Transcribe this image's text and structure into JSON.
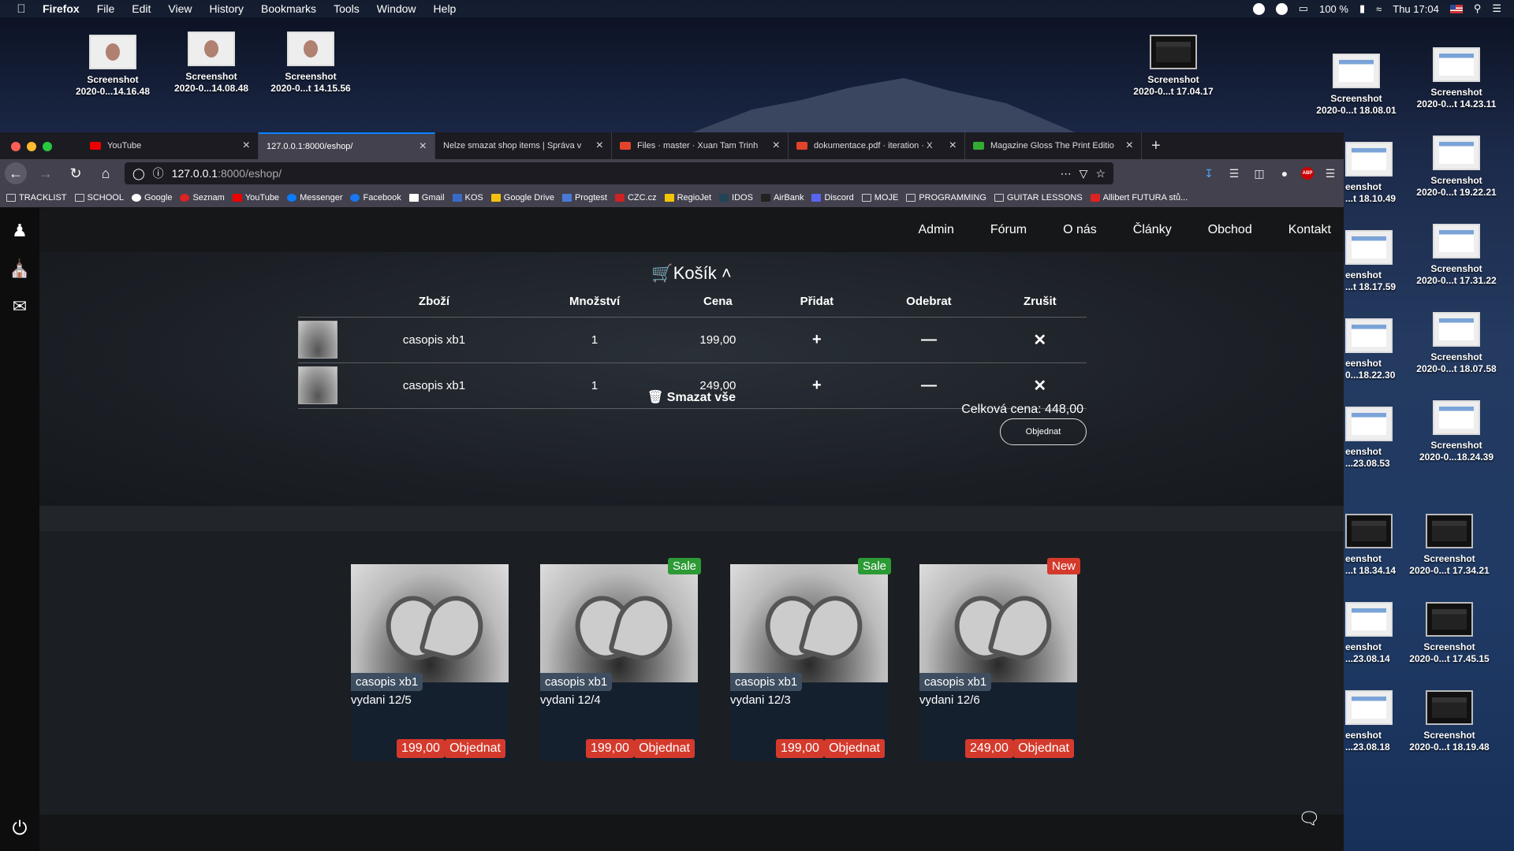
{
  "menubar": {
    "app": "Firefox",
    "items": [
      "File",
      "Edit",
      "View",
      "History",
      "Bookmarks",
      "Tools",
      "Window"
    ],
    "help": "Help",
    "battery": "100 %",
    "clock": "Thu 17:04"
  },
  "desktop": {
    "icons": [
      {
        "l1": "Screenshot",
        "l2": "2020-0...14.16.48"
      },
      {
        "l1": "Screenshot",
        "l2": "2020-0...14.08.48"
      },
      {
        "l1": "Screenshot",
        "l2": "2020-0...t 14.15.56"
      },
      {
        "l1": "Screenshot",
        "l2": "2020-0...t 17.04.17"
      },
      {
        "l1": "Screenshot",
        "l2": "2020-0...t 18.08.01"
      },
      {
        "l1": "Screenshot",
        "l2": "2020-0...t 14.23.11"
      },
      {
        "l1": "eenshot",
        "l2": "...t 18.10.49"
      },
      {
        "l1": "Screenshot",
        "l2": "2020-0...t 19.22.21"
      },
      {
        "l1": "eenshot",
        "l2": "...t 18.17.59"
      },
      {
        "l1": "Screenshot",
        "l2": "2020-0...t 17.31.22"
      },
      {
        "l1": "eenshot",
        "l2": "0...18.22.30"
      },
      {
        "l1": "Screenshot",
        "l2": "2020-0...t 18.07.58"
      },
      {
        "l1": "eenshot",
        "l2": "...23.08.53"
      },
      {
        "l1": "Screenshot",
        "l2": "2020-0...18.24.39"
      },
      {
        "l1": "eenshot",
        "l2": "...t 18.34.14"
      },
      {
        "l1": "Screenshot",
        "l2": "2020-0...t 17.34.21"
      },
      {
        "l1": "eenshot",
        "l2": "...23.08.14"
      },
      {
        "l1": "Screenshot",
        "l2": "2020-0...t 17.45.15"
      },
      {
        "l1": "eenshot",
        "l2": "...23.08.18"
      },
      {
        "l1": "Screenshot",
        "l2": "2020-0...t 18.19.48"
      }
    ]
  },
  "tabs": [
    {
      "title": "YouTube",
      "color": "#e00"
    },
    {
      "title": "127.0.0.1:8000/eshop/",
      "color": ""
    },
    {
      "title": "Nelze smazat shop items | Správa v",
      "color": ""
    },
    {
      "title": "Files · master · Xuan Tam Trinh",
      "color": "#e2432a"
    },
    {
      "title": "dokumentace.pdf · iteration · X",
      "color": "#e2432a"
    },
    {
      "title": "Magazine Gloss The Print Editio",
      "color": "#3a3"
    }
  ],
  "url": {
    "host": "127.0.0.1",
    "path": ":8000/eshop/"
  },
  "bookmarks": [
    "TRACKLIST",
    "SCHOOL",
    "Google",
    "Seznam",
    "YouTube",
    "Messenger",
    "Facebook",
    "Gmail",
    "KOS",
    "Google Drive",
    "Progtest",
    "CZC.cz",
    "RegioJet",
    "IDOS",
    "AirBank",
    "Discord",
    "MOJE",
    "PROGRAMMING",
    "GUITAR LESSONS",
    "Allibert FUTURA stů..."
  ],
  "nav": [
    "Admin",
    "Fórum",
    "O nás",
    "Články",
    "Obchod",
    "Kontakt"
  ],
  "cart": {
    "title": "Košík",
    "headers": [
      "Zboží",
      "Množství",
      "Cena",
      "Přidat",
      "Odebrat",
      "Zrušit"
    ],
    "rows": [
      {
        "name": "casopis xb1",
        "qty": "1",
        "price": "199,00"
      },
      {
        "name": "casopis xb1",
        "qty": "1",
        "price": "249,00"
      }
    ],
    "clear": "Smazat vše",
    "total": "Celková cena: 448,00",
    "order": "Objednat"
  },
  "products": [
    {
      "title": "casopis xb1",
      "sub": "vydani 12/5",
      "price": "199,00",
      "btn": "Objednat",
      "badge": ""
    },
    {
      "title": "casopis xb1",
      "sub": "vydani 12/4",
      "price": "199,00",
      "btn": "Objednat",
      "badge": "Sale"
    },
    {
      "title": "casopis xb1",
      "sub": "vydani 12/3",
      "price": "199,00",
      "btn": "Objednat",
      "badge": "Sale"
    },
    {
      "title": "casopis xb1",
      "sub": "vydani 12/6",
      "price": "249,00",
      "btn": "Objednat",
      "badge": "New"
    }
  ]
}
